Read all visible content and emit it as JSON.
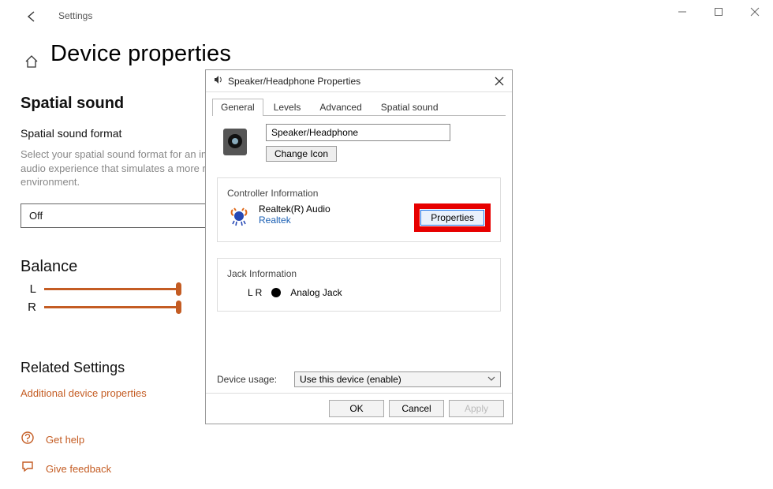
{
  "window": {
    "crumb": "Settings"
  },
  "page": {
    "title": "Device properties"
  },
  "spatial": {
    "title": "Spatial sound",
    "format_label": "Spatial sound format",
    "desc": "Select your spatial sound format for an immersive audio experience that simulates a more realistic environment.",
    "selected": "Off"
  },
  "balance": {
    "title": "Balance",
    "left_label": "L",
    "right_label": "R"
  },
  "related": {
    "title": "Related Settings",
    "link": "Additional device properties"
  },
  "footer": {
    "help": "Get help",
    "feedback": "Give feedback"
  },
  "dialog": {
    "title": "Speaker/Headphone Properties",
    "tabs": [
      "General",
      "Levels",
      "Advanced",
      "Spatial sound"
    ],
    "active_tab": 0,
    "device_name": "Speaker/Headphone",
    "change_icon": "Change Icon",
    "controller": {
      "section": "Controller Information",
      "name": "Realtek(R) Audio",
      "vendor": "Realtek",
      "properties_btn": "Properties"
    },
    "jack": {
      "section": "Jack Information",
      "channels": "L R",
      "label": "Analog Jack"
    },
    "usage": {
      "label": "Device usage:",
      "value": "Use this device (enable)"
    },
    "buttons": {
      "ok": "OK",
      "cancel": "Cancel",
      "apply": "Apply"
    }
  }
}
